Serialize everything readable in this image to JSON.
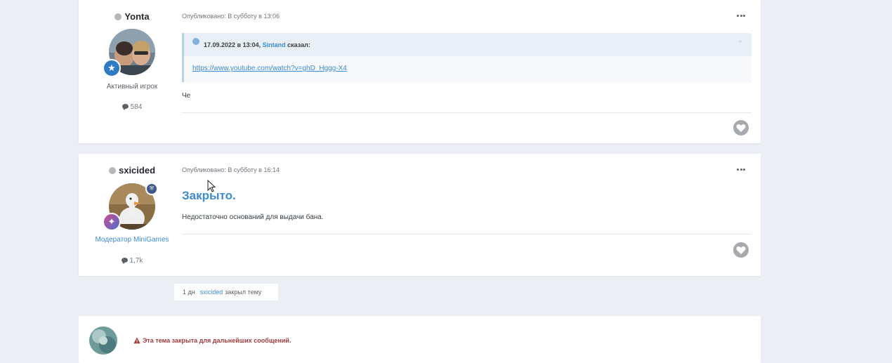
{
  "posts": [
    {
      "author": "Yonta",
      "user_title": "Активный игрок",
      "post_count": "584",
      "meta": "Опубликовано: В субботу в 13:06",
      "quote": {
        "date": "17.09.2022 в 13:04,",
        "user": "Sintand",
        "said": "сказал:",
        "link": "https://www.youtube.com/watch?v=ghD_Hggg-X4"
      },
      "text": "Че"
    },
    {
      "author": "sxicided",
      "user_title": "Модератор MiniGames",
      "post_count": "1,7k",
      "meta": "Опубликовано: В субботу в 16:14",
      "headline": "Закрыто.",
      "text": "Недостаточно оснований для выдачи бана."
    }
  ],
  "event": {
    "time": "1 дн",
    "user": "sxicided",
    "action": "закрыл тему"
  },
  "locked_notice": "Эта тема закрыта для дальнейших сообщений.",
  "icons": {
    "more": "more-icon",
    "heart": "heart-icon",
    "warning": "warning-icon",
    "comment": "comment-icon"
  },
  "colors": {
    "accent": "#3d8bd3",
    "warning": "#a03b3b",
    "background": "#ebeef2"
  }
}
